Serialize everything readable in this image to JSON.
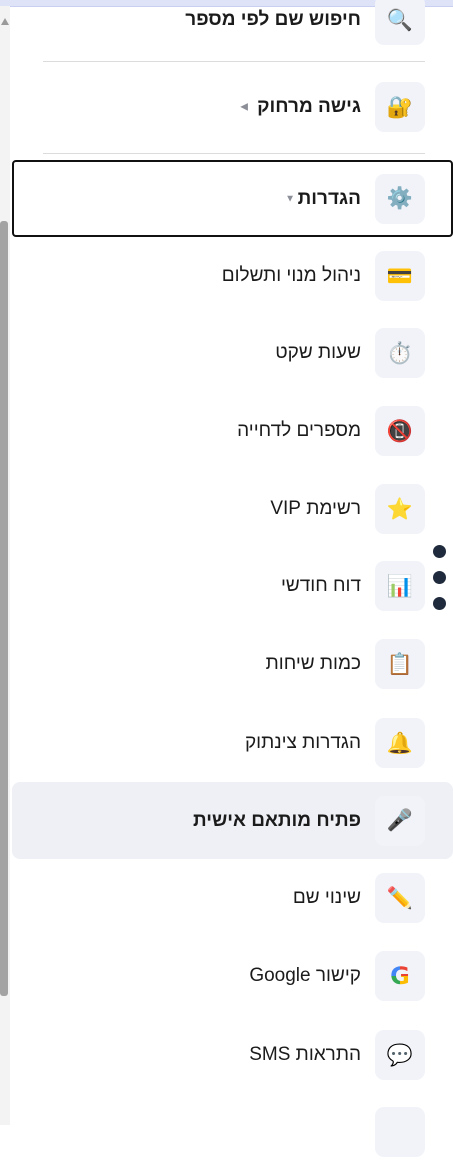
{
  "menu": {
    "items": [
      {
        "label": "חיפוש שם לפי מספר",
        "icon": "magnifier-icon",
        "glyph": "🔍"
      },
      {
        "label": "גישה מרחוק",
        "icon": "lock-key-icon",
        "glyph": "🔐",
        "arrow": "◀"
      },
      {
        "label": "הגדרות",
        "icon": "gear-icon",
        "glyph": "⚙️",
        "arrow": "▼"
      },
      {
        "label": "ניהול מנוי ותשלום",
        "icon": "credit-card-icon",
        "glyph": "💳"
      },
      {
        "label": "שעות שקט",
        "icon": "stopwatch-icon",
        "glyph": "⏱️"
      },
      {
        "label": "מספרים לדחייה",
        "icon": "no-phone-icon",
        "glyph": "📵"
      },
      {
        "label": "רשימת VIP",
        "icon": "star-icon",
        "glyph": "⭐"
      },
      {
        "label": "דוח חודשי",
        "icon": "bar-chart-icon",
        "glyph": "📊"
      },
      {
        "label": "כמות שיחות",
        "icon": "clipboard-icon",
        "glyph": "📋"
      },
      {
        "label": "הגדרות צינתוק",
        "icon": "bell-icon",
        "glyph": "🔔"
      },
      {
        "label": "פתיח מותאם אישית",
        "icon": "microphone-icon",
        "glyph": "🎤"
      },
      {
        "label": "שינוי שם",
        "icon": "pencil-icon",
        "glyph": "✏️"
      },
      {
        "label": "קישור Google",
        "icon": "google-icon",
        "glyph": "G"
      },
      {
        "label": "התראות SMS",
        "icon": "speech-bubble-icon",
        "glyph": "💬"
      }
    ]
  },
  "colors": {
    "icon_box": "#f1f3f9",
    "highlight": "#eef0f5",
    "dots": "#1f2a3c"
  }
}
